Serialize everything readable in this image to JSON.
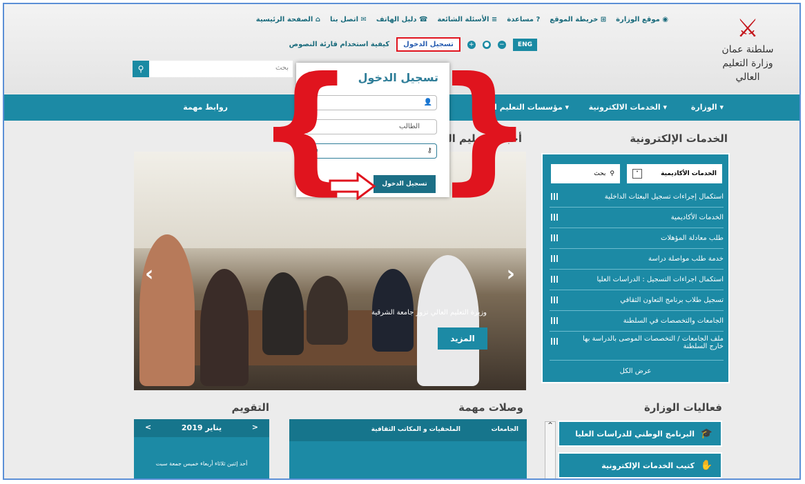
{
  "top_links": [
    "الصفحة الرئيسية",
    "اتصل بنا",
    "دليل الهاتف",
    "الأسئلة الشائعة",
    "مساعدة",
    "خريطة الموقع",
    "موقع الوزارة"
  ],
  "toolbar": {
    "howto": "كيفية استخدام قارئة النصوص",
    "login": "تسجيل الدخول",
    "eng": "ENG"
  },
  "logo": {
    "line1": "سلطنة عمان",
    "line2": "وزارة التعليم العالي"
  },
  "search": {
    "placeholder": "بحث"
  },
  "nav": {
    "ministry": "الوزارة ▾",
    "eservices": "الخدمات الالكترونية ▾",
    "institutions": "مؤسسات التعليم العالي ▾",
    "important_links": "روابط مهمة"
  },
  "sections": {
    "eservices_title": "الخدمات الإلكترونية",
    "news_title": "أخبار التعليم العالي",
    "activities_title": "فعاليات الوزارة",
    "links_title": "وصلات مهمة",
    "calendar_title": "التقويم"
  },
  "eservices": {
    "select_value": "الخدمات الأكاديمية",
    "search_label": "بحث",
    "items": [
      "استكمال إجراءات تسجيل البعثات الداخلية",
      "الخدمات الأكاديمية",
      "طلب معادلة المؤهلات",
      "خدمة طلب مواصلة دراسة",
      "استكمال اجراءات التسجيل : الدراسات العليا",
      "تسجيل طلاب برنامج التعاون الثقافي",
      "الجامعات والتخصصات في السلطنة",
      "ملف الجامعات / التخصصات الموصى بالدراسة بها خارج السلطنة"
    ],
    "view_all": "عرض الكل"
  },
  "news": {
    "caption": "وزيرة التعليم العالي تزور جامعة الشرقية",
    "more": "المزيد"
  },
  "calendar": {
    "month": "يناير 2019",
    "days": "أحد إثنين ثلاثاء أربعاء خميس جمعة سبت"
  },
  "links_tabs": {
    "universities": "الجامعات",
    "attaches": "الملحقيات و المكاتب الثقافية"
  },
  "activities": [
    "البرنامج الوطني للدراسات العليا",
    "كتيب الخدمات الإلكترونية"
  ],
  "login_modal": {
    "title": "تسجيل الدخول",
    "close": "×",
    "user_type": "الطالب",
    "submit": "تسجيل الدخول"
  },
  "colors": {
    "primary": "#1c8aa5",
    "highlight": "#e0141e"
  }
}
